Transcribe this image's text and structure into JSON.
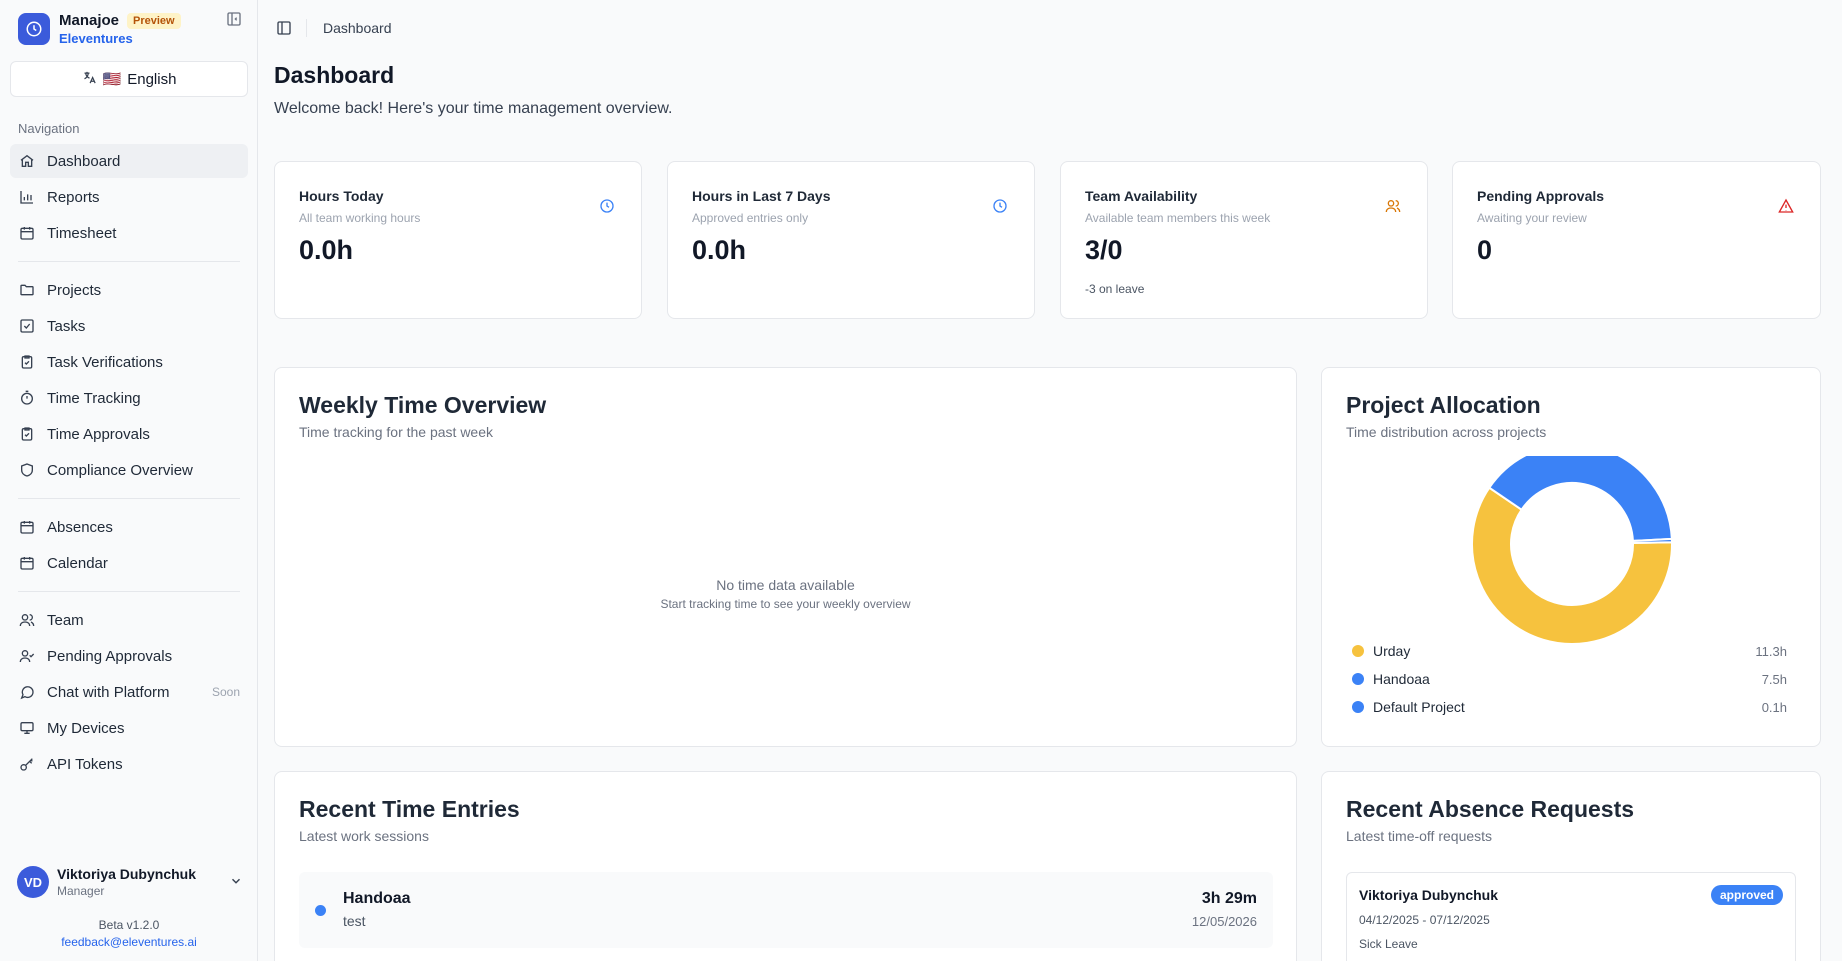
{
  "brand": {
    "name": "Manajoe",
    "badge": "Preview",
    "org": "Eleventures"
  },
  "language": {
    "flag": "🇺🇸",
    "label": "English"
  },
  "sidebar": {
    "section_label": "Navigation",
    "items": [
      {
        "label": "Dashboard",
        "icon": "home-icon"
      },
      {
        "label": "Reports",
        "icon": "bar-chart-icon"
      },
      {
        "label": "Timesheet",
        "icon": "calendar-icon"
      },
      {
        "label": "Projects",
        "icon": "folder-icon"
      },
      {
        "label": "Tasks",
        "icon": "checkbox-icon"
      },
      {
        "label": "Task Verifications",
        "icon": "clipboard-check-icon"
      },
      {
        "label": "Time Tracking",
        "icon": "timer-icon"
      },
      {
        "label": "Time Approvals",
        "icon": "clipboard-check-icon"
      },
      {
        "label": "Compliance Overview",
        "icon": "shield-icon"
      },
      {
        "label": "Absences",
        "icon": "calendar-icon"
      },
      {
        "label": "Calendar",
        "icon": "calendar-icon"
      },
      {
        "label": "Team",
        "icon": "users-icon"
      },
      {
        "label": "Pending Approvals",
        "icon": "user-check-icon"
      },
      {
        "label": "Chat with Platform",
        "icon": "chat-icon",
        "tag": "Soon"
      },
      {
        "label": "My Devices",
        "icon": "monitor-icon"
      },
      {
        "label": "API Tokens",
        "icon": "key-icon"
      }
    ]
  },
  "user": {
    "initials": "VD",
    "name": "Viktoriya Dubynchuk",
    "role": "Manager"
  },
  "footer": {
    "version": "Beta v1.2.0",
    "email": "feedback@eleventures.ai"
  },
  "header": {
    "breadcrumb": "Dashboard",
    "title": "Dashboard",
    "subtitle": "Welcome back! Here's your time management overview."
  },
  "stats": [
    {
      "title": "Hours Today",
      "subtitle": "All team working hours",
      "value": "0.0h",
      "note": "",
      "icon": "clock-icon",
      "color": "#3b82f6"
    },
    {
      "title": "Hours in Last 7 Days",
      "subtitle": "Approved entries only",
      "value": "0.0h",
      "note": "",
      "icon": "clock-icon",
      "color": "#3b82f6"
    },
    {
      "title": "Team Availability",
      "subtitle": "Available team members this week",
      "value": "3/0",
      "note": "-3 on leave",
      "icon": "users-icon",
      "color": "#d97706"
    },
    {
      "title": "Pending Approvals",
      "subtitle": "Awaiting your review",
      "value": "0",
      "note": "",
      "icon": "alert-triangle-icon",
      "color": "#dc2626"
    }
  ],
  "weekly": {
    "title": "Weekly Time Overview",
    "subtitle": "Time tracking for the past week",
    "empty_title": "No time data available",
    "empty_subtitle": "Start tracking time to see your weekly overview"
  },
  "allocation": {
    "title": "Project Allocation",
    "subtitle": "Time distribution across projects"
  },
  "chart_data": {
    "type": "pie",
    "donut": true,
    "categories": [
      "Urday",
      "Handoaa",
      "Default Project"
    ],
    "values": [
      11.3,
      7.5,
      0.1
    ],
    "value_labels": [
      "11.3h",
      "7.5h",
      "0.1h"
    ],
    "colors": [
      "#f6c23e",
      "#3b82f6",
      "#3b82f6"
    ],
    "legend": "bottom"
  },
  "recent_entries": {
    "title": "Recent Time Entries",
    "subtitle": "Latest work sessions",
    "items": [
      {
        "project": "Handoaa",
        "description": "test",
        "duration": "3h 29m",
        "date": "12/05/2026"
      }
    ]
  },
  "recent_absences": {
    "title": "Recent Absence Requests",
    "subtitle": "Latest time-off requests",
    "items": [
      {
        "name": "Viktoriya Dubynchuk",
        "dates": "04/12/2025 - 07/12/2025",
        "type": "Sick Leave",
        "status": "approved"
      }
    ]
  }
}
